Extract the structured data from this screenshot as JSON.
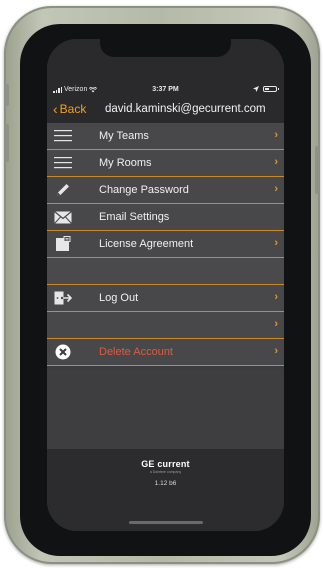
{
  "status_bar": {
    "carrier": "Verizon",
    "time": "3:37 PM"
  },
  "navbar": {
    "back_label": "Back",
    "title": "david.kaminski@gecurrent.com"
  },
  "menu": {
    "items": [
      {
        "label": "My Teams",
        "icon": "hamburger-icon",
        "chevron": true
      },
      {
        "label": "My Rooms",
        "icon": "hamburger-icon",
        "chevron": true
      },
      {
        "label": "Change Password",
        "icon": "pencil-icon",
        "chevron": true
      },
      {
        "label": "Email Settings",
        "icon": "envelope-icon",
        "chevron": false
      },
      {
        "label": "License Agreement",
        "icon": "document-icon",
        "chevron": true
      },
      {
        "label": "Log Out",
        "icon": "logout-icon",
        "chevron": true
      },
      {
        "label": "Delete Account",
        "icon": "x-circle-icon",
        "chevron": true
      }
    ]
  },
  "footer": {
    "brand": "GE current",
    "brand_sub": "a Daintree company",
    "version": "1.12 b6"
  },
  "colors": {
    "accent": "#f0a020",
    "row_divider": "#c98a2a",
    "danger": "#e05a3c"
  }
}
